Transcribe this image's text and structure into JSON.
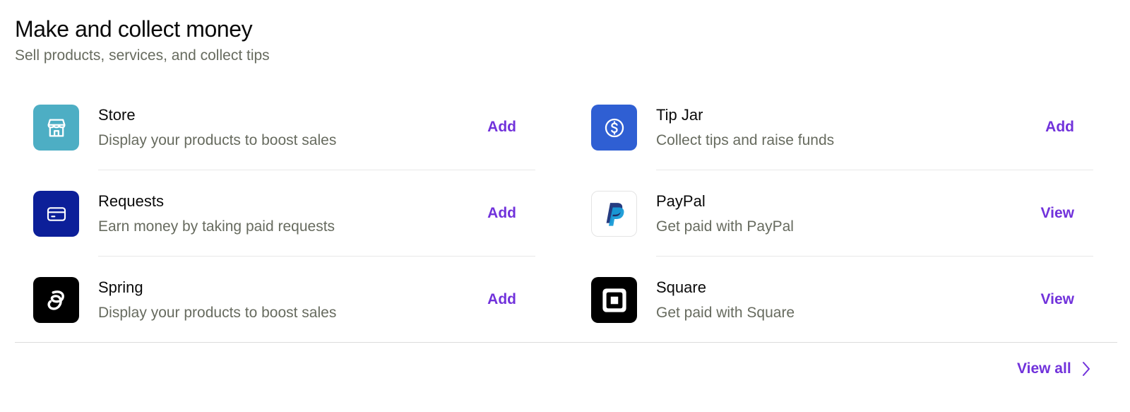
{
  "header": {
    "title": "Make and collect money",
    "subtitle": "Sell products, services, and collect tips"
  },
  "left_items": [
    {
      "name": "Store",
      "description": "Display your products to boost sales",
      "action": "Add",
      "icon": "store-icon",
      "icon_bg": "#4daec4"
    },
    {
      "name": "Requests",
      "description": "Earn money by taking paid requests",
      "action": "Add",
      "icon": "card-icon",
      "icon_bg": "#0c1f99"
    },
    {
      "name": "Spring",
      "description": "Display your products to boost sales",
      "action": "Add",
      "icon": "spring-logo-icon",
      "icon_bg": "#000000"
    }
  ],
  "right_items": [
    {
      "name": "Tip Jar",
      "description": "Collect tips and raise funds",
      "action": "Add",
      "icon": "dollar-coin-icon",
      "icon_bg": "#2f5fd3"
    },
    {
      "name": "PayPal",
      "description": "Get paid with PayPal",
      "action": "View",
      "icon": "paypal-logo-icon",
      "icon_bg": "#ffffff"
    },
    {
      "name": "Square",
      "description": "Get paid with Square",
      "action": "View",
      "icon": "square-logo-icon",
      "icon_bg": "#000000"
    }
  ],
  "footer": {
    "view_all_label": "View all"
  },
  "colors": {
    "accent": "#7132db",
    "muted_text": "#676b5f"
  }
}
